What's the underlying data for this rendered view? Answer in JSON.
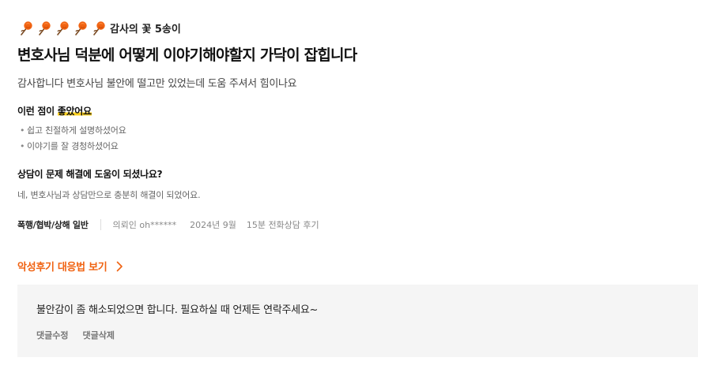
{
  "review": {
    "flowers": {
      "count": 5,
      "label": "감사의 꽃 5송이",
      "color": "#f06211"
    },
    "title": "변호사님 덕분에 어떻게 이야기해야할지 가닥이 잡힙니다",
    "body": "감사합니다 변호사님 불안에 떨고만 있었는데 도움 주셔서 힘이나요",
    "good_points": {
      "title_prefix": "이런 점이 ",
      "title_highlight": "좋았어요",
      "items": [
        "쉽고 친절하게 설명하셨어요",
        "이야기를 잘 경청하셨어요"
      ]
    },
    "question": {
      "title": "상담이 문제 해결에 도움이 되셨나요?",
      "answer": "네, 변호사님과 상담만으로 충분히 해결이 되었어요."
    },
    "meta": {
      "category": "폭행/협박/상해 일반",
      "client": "의뢰인 oh******",
      "date": "2024년 9월",
      "type": "15분 전화상담 후기"
    }
  },
  "bad_review_link": {
    "label": "악성후기 대응법 보기",
    "color": "#f06211"
  },
  "reply": {
    "text": "불안감이 좀 해소되었으면 합니다. 필요하실 때 언제든 연락주세요~",
    "edit_label": "댓글수정",
    "delete_label": "댓글삭제"
  }
}
